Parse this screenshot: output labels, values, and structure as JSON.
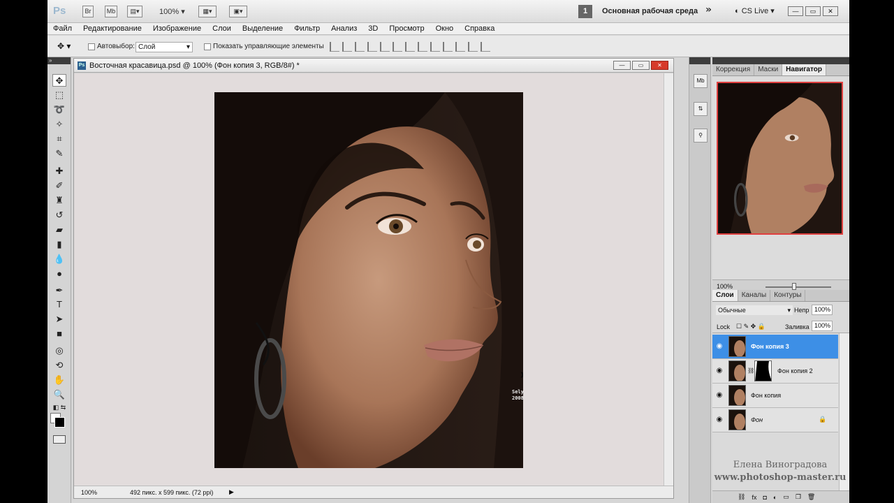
{
  "appbar": {
    "logo": "Ps",
    "bridge": "Br",
    "mini_bridge": "Mb",
    "zoom": "100%",
    "workspace_number": "1",
    "workspace": "Основная рабочая среда",
    "cs_live": "CS Live"
  },
  "menu": [
    "Файл",
    "Редактирование",
    "Изображение",
    "Слои",
    "Выделение",
    "Фильтр",
    "Анализ",
    "3D",
    "Просмотр",
    "Окно",
    "Справка"
  ],
  "options": {
    "auto_select_label": "Автовыбор:",
    "auto_select_value": "Слой",
    "show_controls_label": "Показать управляющие элементы"
  },
  "document": {
    "title": "Восточная красавица.psd @ 100% (Фон копия 3, RGB/8#) *",
    "status_zoom": "100%",
    "status_info": "492 пикс. x 599 пикс. (72 ppi)",
    "credit": "Selyanin 2008"
  },
  "iconstrip": [
    "Mb",
    "",
    ""
  ],
  "panels": {
    "tabs_top": [
      "Коррекция",
      "Маски",
      "Навигатор"
    ],
    "nav_zoom": "100%",
    "tabs_layers": [
      "Слои",
      "Каналы",
      "Контуры"
    ],
    "blend_mode": "Обычные",
    "opacity_label": "Непр",
    "opacity": "100%",
    "lock_label": "Lock",
    "fill_label": "Заливка",
    "fill": "100%"
  },
  "layers": [
    {
      "name": "Фон копия 3",
      "selected": true
    },
    {
      "name": "Фон копия 2",
      "selected": false
    },
    {
      "name": "Фон копия",
      "selected": false
    },
    {
      "name": "Фон",
      "selected": false
    }
  ],
  "watermark": {
    "line1": "Елена Виноградова",
    "line2": "www.photoshop-master.ru"
  }
}
